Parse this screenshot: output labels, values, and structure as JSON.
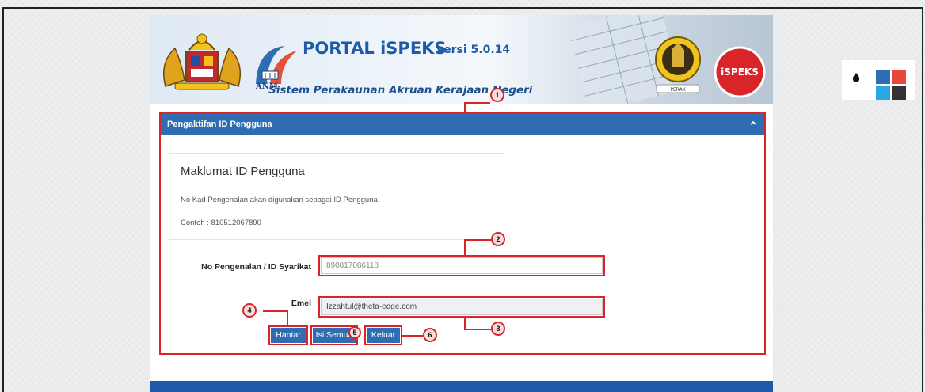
{
  "banner": {
    "title": "PORTAL iSPEKS",
    "version": "versi 5.0.14",
    "subtitle": "Sistem Perakaunan Akruan Kerajaan Negeri",
    "anm_label": "ANM",
    "perak_label": "PERAK",
    "ispeks_logo_label": "iSPEKS"
  },
  "panel": {
    "title": "Pengaktifan ID Pengguna",
    "card": {
      "heading": "Maklumat ID Pengguna",
      "line1": "No Kad Pengenalan akan digunakan sebagai ID Pengguna.",
      "line2": "Contoh : 810512067890"
    },
    "form": {
      "id_label": "No Pengenalan / ID Syarikat",
      "id_value": "890817086118",
      "email_label": "Emel",
      "email_value": "Izzahtul@theta-edge.com"
    },
    "buttons": {
      "submit": "Hantar",
      "fill_all": "Isi Semua",
      "exit": "Keluar"
    }
  },
  "callouts": [
    "1",
    "2",
    "3",
    "4",
    "5",
    "6"
  ],
  "colors": {
    "primary": "#2f6db2",
    "annotation": "#d9252a",
    "swatches": [
      "#2f6db2",
      "#e8473b",
      "#27a9e1",
      "#333333"
    ]
  },
  "icons": [
    "drop-icon",
    "chevron-up-icon"
  ]
}
